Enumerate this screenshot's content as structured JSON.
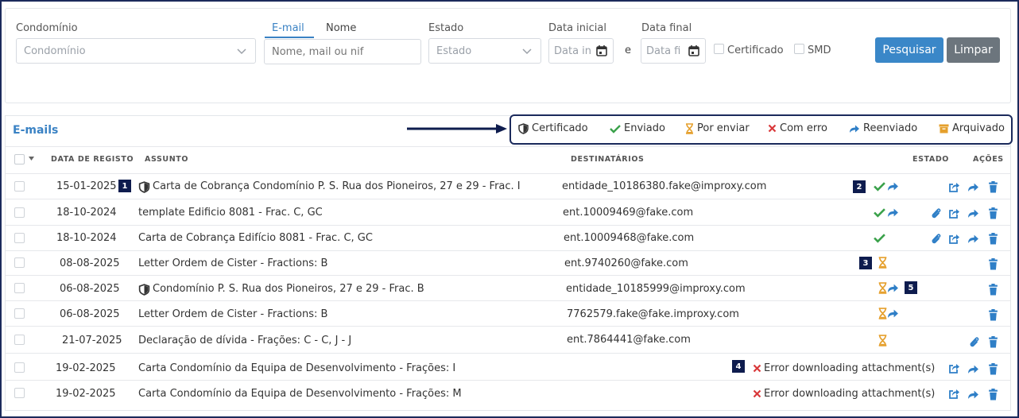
{
  "filters": {
    "condominio_label": "Condomínio",
    "condominio_placeholder": "Condomínio",
    "tab_email": "E-mail",
    "tab_nome": "Nome",
    "search_placeholder": "Nome, mail ou nif",
    "estado_label": "Estado",
    "estado_placeholder": "Estado",
    "data_inicial_label": "Data inicial",
    "data_inicial_placeholder": "Data in",
    "e_text": "e",
    "data_final_label": "Data final",
    "data_final_placeholder": "Data fi",
    "certificado_label": "Certificado",
    "smd_label": "SMD",
    "search_button": "Pesquisar",
    "clear_button": "Limpar"
  },
  "emails_title": "E-mails",
  "legend": {
    "certificado": "Certificado",
    "enviado": "Enviado",
    "por_enviar": "Por enviar",
    "com_erro": "Com erro",
    "reenviado": "Reenviado",
    "arquivado": "Arquivado"
  },
  "table": {
    "headers": {
      "date": "DATA DE REGISTO",
      "subject": "ASSUNTO",
      "recipients": "DESTINATÁRIOS",
      "state": "ESTADO",
      "actions": "AÇÕES"
    },
    "rows": [
      {
        "date": "15-01-2025",
        "subject": "Carta de Cobrança Condomínio P. S. Rua dos Pioneiros, 27 e 29 - Frac. I",
        "recipient": "entidade_10186380.fake@improxy.com",
        "error": ""
      },
      {
        "date": "18-10-2024",
        "subject": "template Edificio 8081 - Frac. C, GC",
        "recipient": "ent.10009469@fake.com",
        "error": ""
      },
      {
        "date": "18-10-2024",
        "subject": "Carta de Cobrança Edifício 8081 - Frac. C, GC",
        "recipient": "ent.10009468@fake.com",
        "error": ""
      },
      {
        "date": "08-08-2025",
        "subject": "Letter Ordem de Cister - Fractions: B",
        "recipient": "ent.9740260@fake.com",
        "error": ""
      },
      {
        "date": "06-08-2025",
        "subject": "Condomínio P. S. Rua dos Pioneiros, 27 e 29 - Frac. B",
        "recipient": "entidade_10185999@improxy.com",
        "error": ""
      },
      {
        "date": "06-08-2025",
        "subject": "Letter Ordem de Cister - Fractions: B",
        "recipient": "7762579.fake@fake.improxy.com",
        "error": ""
      },
      {
        "date": "21-07-2025",
        "subject": "Declaração de dívida - Frações: C - C, J - J",
        "recipient": "ent.7864441@fake.com",
        "error": ""
      },
      {
        "date": "19-02-2025",
        "subject": "Carta Condomínio da Equipa de Desenvolvimento - Frações: I",
        "recipient": "",
        "error": "Error downloading attachment(s)"
      },
      {
        "date": "19-02-2025",
        "subject": "Carta Condomínio da Equipa de Desenvolvimento - Frações: M",
        "recipient": "",
        "error": "Error downloading attachment(s)"
      }
    ]
  },
  "markers": [
    "1",
    "2",
    "3",
    "4",
    "5"
  ],
  "colors": {
    "accent": "#3a82c4",
    "success": "#3aa14a",
    "pending": "#e5a02d",
    "error": "#d9383a",
    "navy": "#1b2a5c"
  }
}
